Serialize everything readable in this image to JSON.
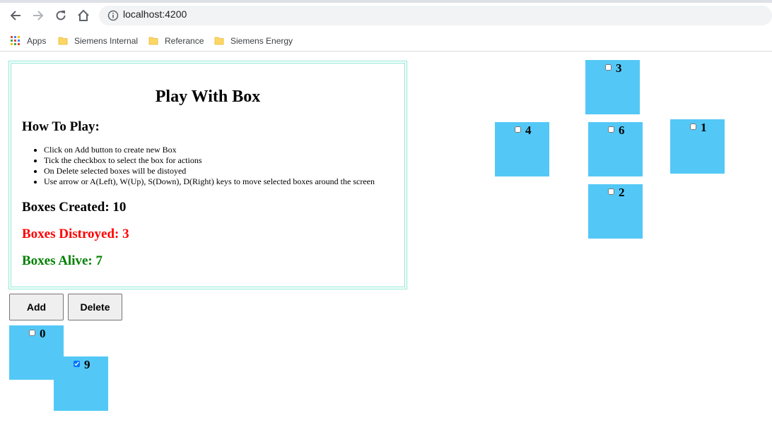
{
  "browser": {
    "url": "localhost:4200",
    "bookmarks": [
      {
        "label": "Apps",
        "icon": "apps-grid-icon"
      },
      {
        "label": "Siemens Internal",
        "icon": "folder-icon"
      },
      {
        "label": "Referance",
        "icon": "folder-icon"
      },
      {
        "label": "Siemens Energy",
        "icon": "folder-icon"
      }
    ]
  },
  "game": {
    "title": "Play With Box",
    "howto_heading": "How To Play:",
    "rules": [
      "Click on Add button to create new Box",
      "Tick the checkbox to select the box for actions",
      "On Delete selected boxes will be distoyed",
      "Use arrow or A(Left), W(Up), S(Down), D(Right) keys to move selected boxes around the screen"
    ],
    "stats": {
      "created": "Boxes Created: 10",
      "destroyed": "Boxes Distroyed: 3",
      "alive": "Boxes Alive: 7"
    },
    "buttons": {
      "add": "Add",
      "delete": "Delete"
    },
    "boxes": [
      {
        "id": "3",
        "checked": false
      },
      {
        "id": "4",
        "checked": false
      },
      {
        "id": "6",
        "checked": false
      },
      {
        "id": "1",
        "checked": false
      },
      {
        "id": "2",
        "checked": false
      },
      {
        "id": "0",
        "checked": false
      },
      {
        "id": "9",
        "checked": true
      }
    ]
  },
  "colors": {
    "box": "#53c8f6",
    "destroyed": "#ff0000",
    "alive": "#008000",
    "panel_border": "#90e8d5"
  }
}
